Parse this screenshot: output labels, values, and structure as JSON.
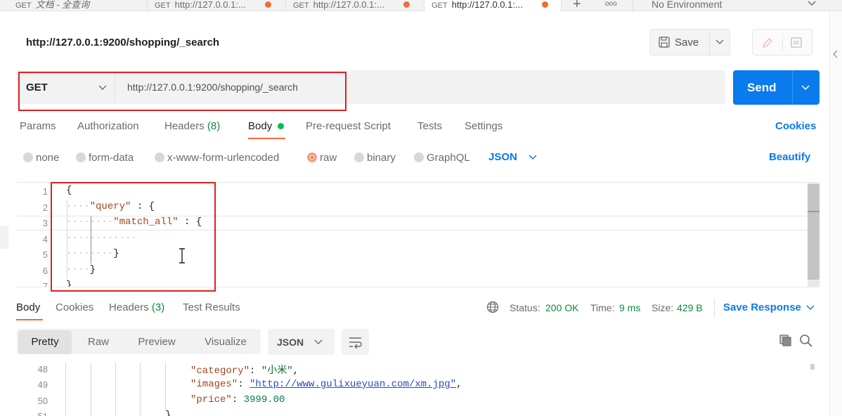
{
  "tabs": [
    {
      "method": "GET",
      "title": "文档 - 全查询",
      "active": false,
      "modified": false
    },
    {
      "method": "GET",
      "title": "http://127.0.0.1:...",
      "active": false,
      "modified": true
    },
    {
      "method": "GET",
      "title": "http://127.0.0.1:...",
      "active": false,
      "modified": true
    },
    {
      "method": "GET",
      "title": "http://127.0.0.1:...",
      "active": true,
      "modified": true
    }
  ],
  "tabbar": {
    "add_icon": "+",
    "more_icon": "ooo",
    "environment": "No Environment"
  },
  "request": {
    "name": "http://127.0.0.1:9200/shopping/_search",
    "save_label": "Save",
    "method": "GET",
    "url": "http://127.0.0.1:9200/shopping/_search",
    "send_label": "Send"
  },
  "request_tabs": {
    "params": "Params",
    "authorization": "Authorization",
    "headers": "Headers",
    "headers_count": "(8)",
    "body": "Body",
    "pre_request": "Pre-request Script",
    "tests": "Tests",
    "settings": "Settings",
    "cookies": "Cookies"
  },
  "body_types": {
    "none": "none",
    "form_data": "form-data",
    "urlencoded": "x-www-form-urlencoded",
    "raw": "raw",
    "binary": "binary",
    "graphql": "GraphQL",
    "format": "JSON",
    "beautify": "Beautify"
  },
  "editor": {
    "line_numbers": [
      "1",
      "2",
      "3",
      "4",
      "5",
      "6",
      "7"
    ],
    "l1": "{",
    "l2_key": "\"query\"",
    "l2_rest": " : {",
    "l3_key": "\"match_all\"",
    "l3_rest": " : {",
    "l5": "}",
    "l6": "}",
    "l7": "}"
  },
  "response_tabs": {
    "body": "Body",
    "cookies": "Cookies",
    "headers": "Headers",
    "headers_count": "(3)",
    "test_results": "Test Results"
  },
  "response_status": {
    "status_label": "Status:",
    "status_value": "200 OK",
    "time_label": "Time:",
    "time_value": "9 ms",
    "size_label": "Size:",
    "size_value": "429 B",
    "save_response": "Save Response"
  },
  "response_view": {
    "pretty": "Pretty",
    "raw": "Raw",
    "preview": "Preview",
    "visualize": "Visualize",
    "format": "JSON"
  },
  "response_body": {
    "line_numbers": [
      "48",
      "49",
      "50",
      "51"
    ],
    "l48_key": "\"category\"",
    "l48_val": "\"小米\"",
    "l49_key": "\"images\"",
    "l49_val": "\"http://www.gulixueyuan.com/xm.jpg\"",
    "l50_key": "\"price\"",
    "l50_val": "3999.00",
    "l51": "}"
  },
  "colors": {
    "accent": "#097bed",
    "modified_dot": "#f26b3a",
    "body_dot": "#0cbb52",
    "highlight": "#e02020"
  }
}
